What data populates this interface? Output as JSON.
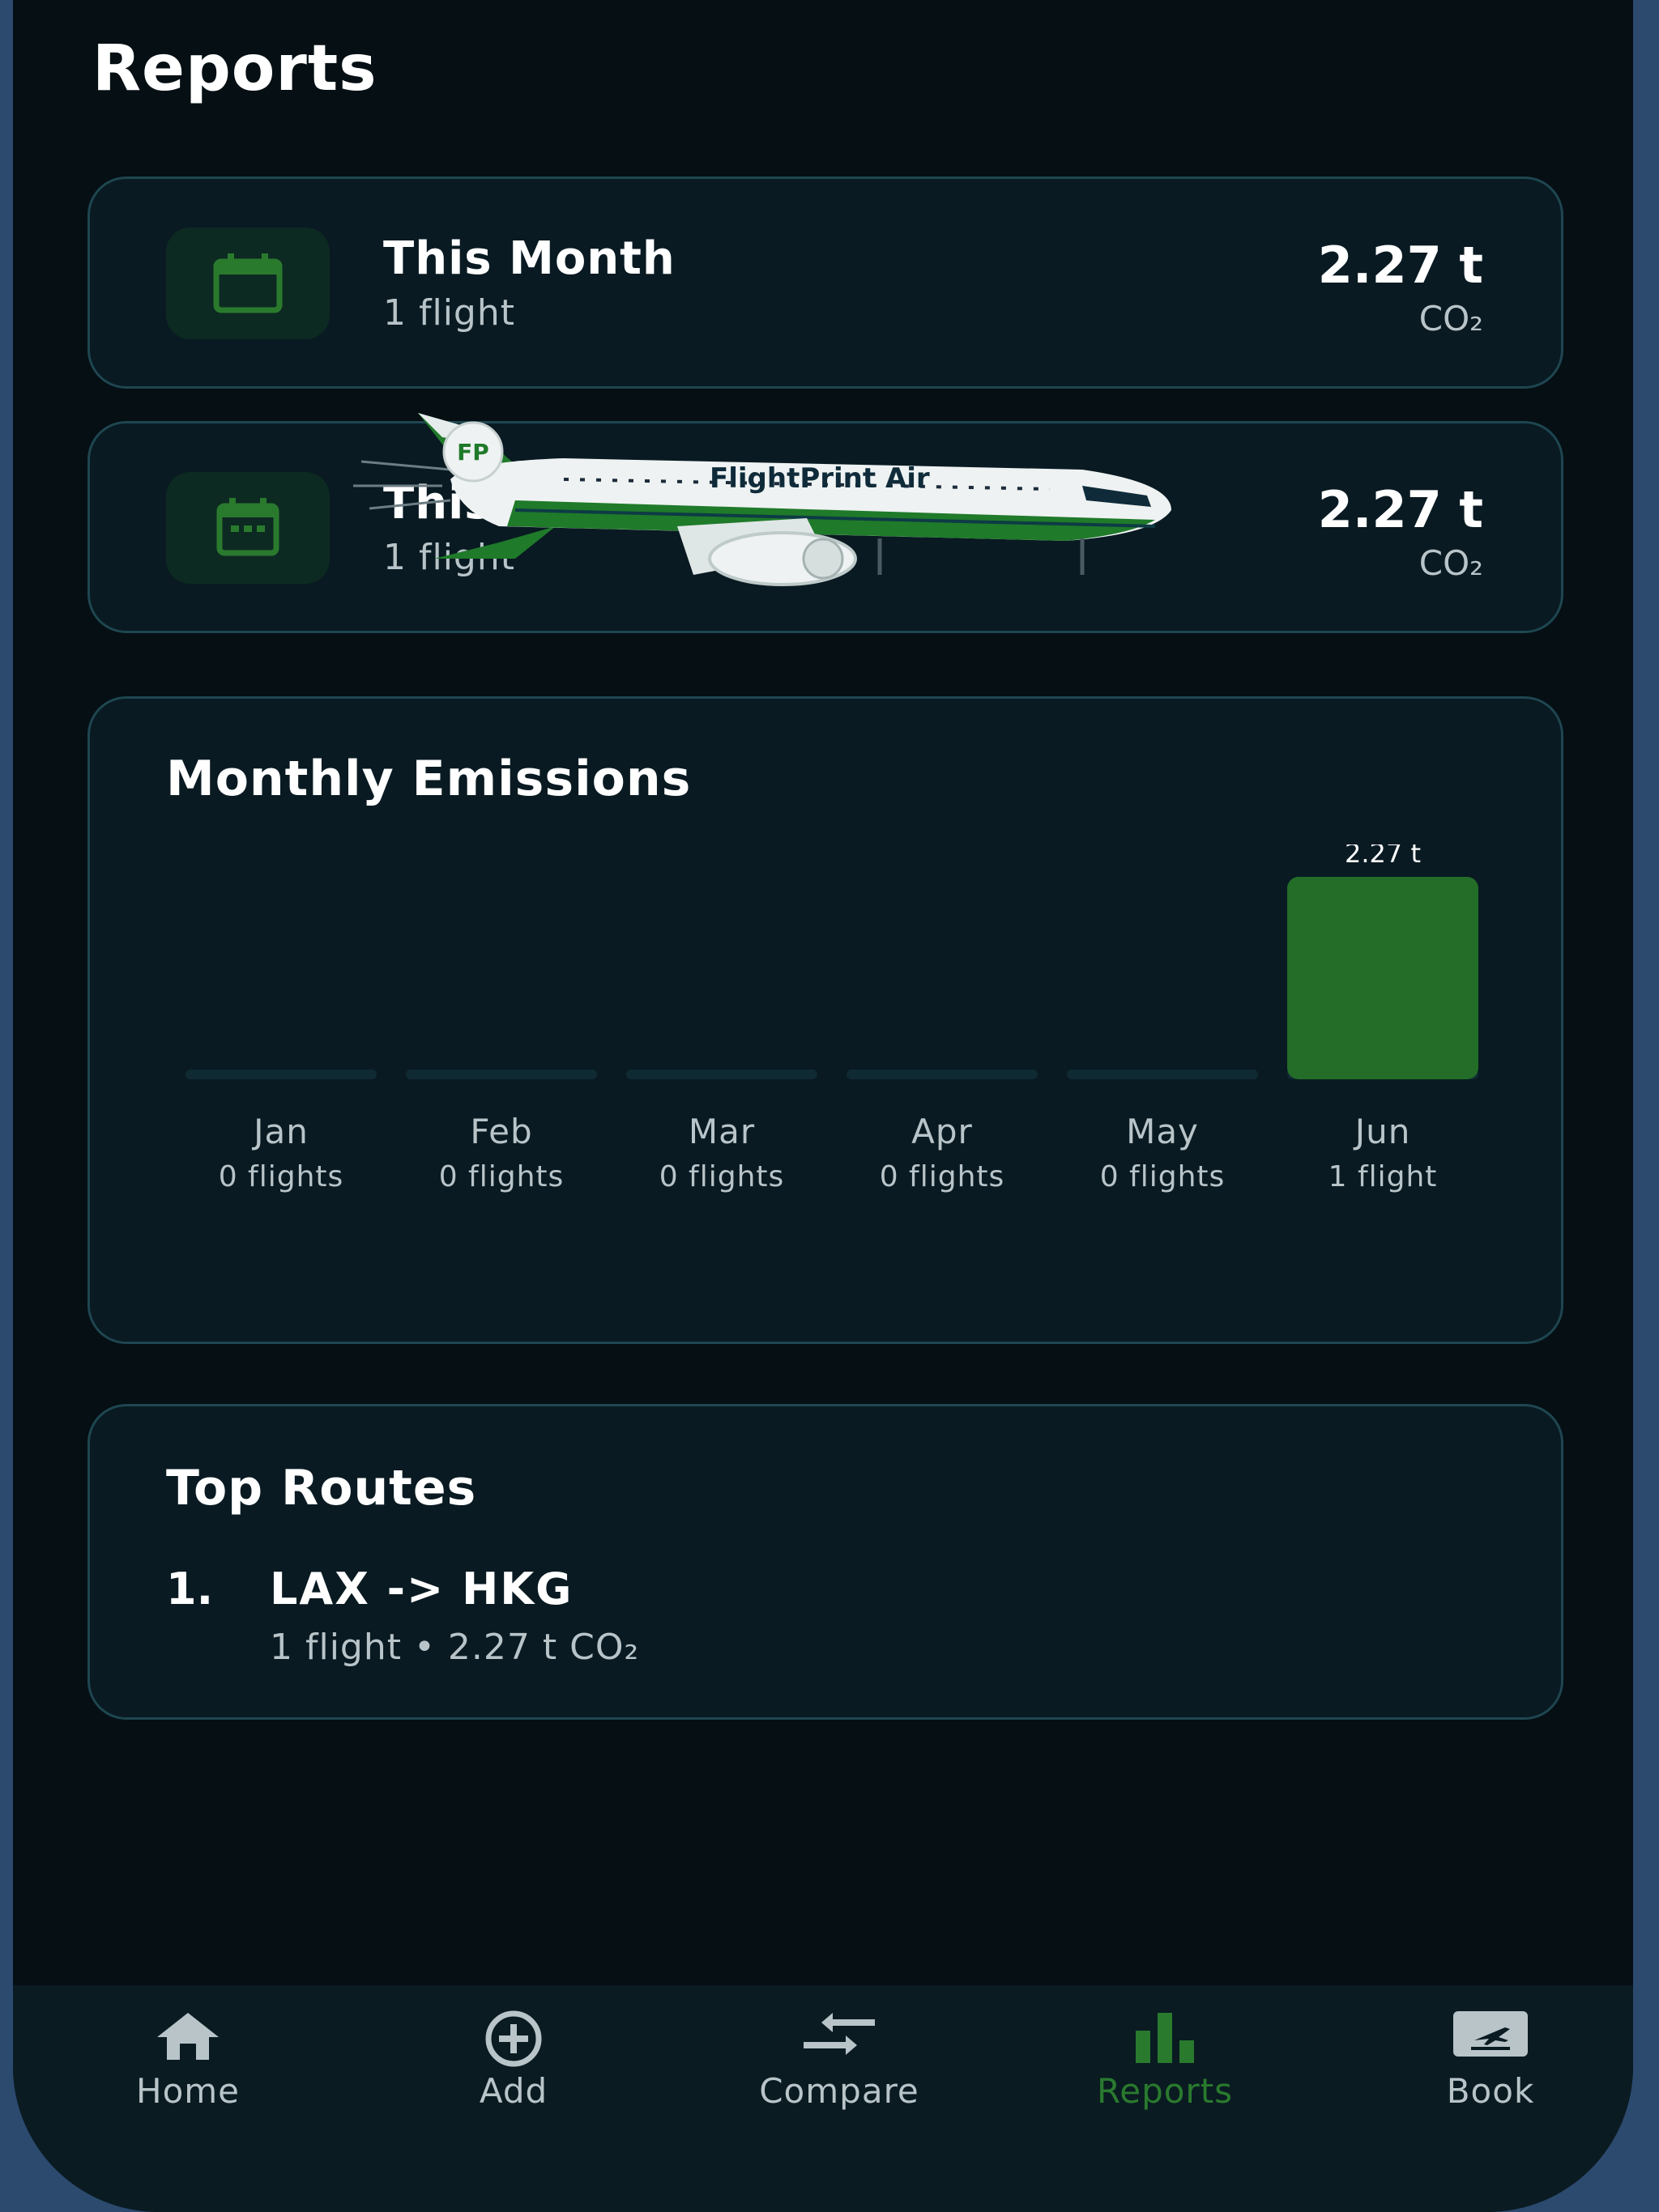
{
  "page_title": "Reports",
  "summary_cards": [
    {
      "title": "This Month",
      "subtitle": "1 flight",
      "value": "2.27 t",
      "unit": "CO₂"
    },
    {
      "title": "This Year",
      "subtitle": "1 flight",
      "value": "2.27 t",
      "unit": "CO₂"
    }
  ],
  "monthly": {
    "title": "Monthly Emissions"
  },
  "chart_data": {
    "type": "bar",
    "categories": [
      "Jan",
      "Feb",
      "Mar",
      "Apr",
      "May",
      "Jun"
    ],
    "values": [
      0,
      0,
      0,
      0,
      0,
      2.27
    ],
    "value_labels": [
      "",
      "",
      "",
      "",
      "",
      "2.27 t"
    ],
    "flight_labels": [
      "0 flights",
      "0 flights",
      "0 flights",
      "0 flights",
      "0 flights",
      "1 flight"
    ],
    "ylim": [
      0,
      2.27
    ],
    "bar_color": "#236d28",
    "track_color": "#102a33",
    "title": "Monthly Emissions",
    "xlabel": "",
    "ylabel": ""
  },
  "top_routes": {
    "title": "Top Routes",
    "items": [
      {
        "rank": "1.",
        "route": "LAX -> HKG",
        "detail": "1 flight • 2.27 t CO₂"
      }
    ]
  },
  "plane": {
    "livery_text": "FlightPrint Air",
    "badge": "FP"
  },
  "nav": {
    "items": [
      {
        "label": "Home",
        "icon": "home-icon"
      },
      {
        "label": "Add",
        "icon": "add-circle-icon"
      },
      {
        "label": "Compare",
        "icon": "compare-arrows-icon"
      },
      {
        "label": "Reports",
        "icon": "bar-chart-icon",
        "active": true
      },
      {
        "label": "Book",
        "icon": "flight-ticket-icon"
      }
    ],
    "active_color": "#2a7a2e",
    "inactive_color": "#b8c4c8"
  }
}
